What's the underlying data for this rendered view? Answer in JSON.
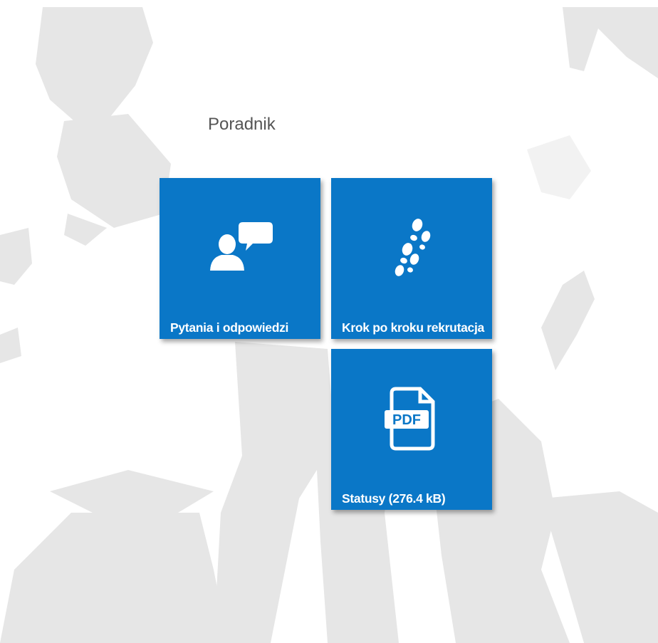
{
  "page": {
    "title": "Poradnik"
  },
  "tiles": [
    {
      "label": "Pytania i odpowiedzi",
      "icon": "chat-person-icon"
    },
    {
      "label": "Krok po kroku rekrutacja",
      "icon": "footprints-icon"
    },
    {
      "label": "Statusy (276.4 kB)",
      "icon": "pdf-file-icon"
    }
  ],
  "colors": {
    "tile": "#0a77c7",
    "background_silhouettes": "#e5e5e5",
    "title": "#555555"
  }
}
